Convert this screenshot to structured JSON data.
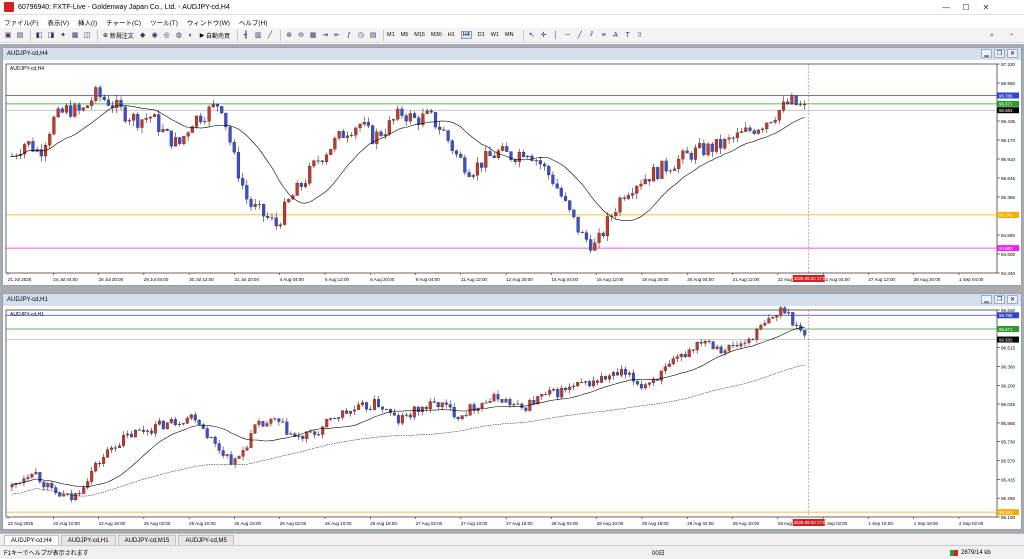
{
  "window": {
    "title": "60796940: FXTF-Live - Goldenway Japan Co., Ltd. - AUDJPY-cd,H4",
    "min": "—",
    "max": "☐",
    "close": "✕"
  },
  "menu": [
    "ファイル(F)",
    "表示(V)",
    "挿入(I)",
    "チャート(C)",
    "ツール(T)",
    "ウィンドウ(W)",
    "ヘルプ(H)"
  ],
  "toolbar": {
    "new_order": "新規注文",
    "auto_trade": "自動売買",
    "timeframes": [
      "M1",
      "M5",
      "M15",
      "M30",
      "H1",
      "H4",
      "D1",
      "W1",
      "MN"
    ],
    "active_timeframe": "H4"
  },
  "chart_top": {
    "window_title": "AUDJPY-cd,H4",
    "label": "AUDJPY-cd,H4",
    "price_ticks": [
      "97.220",
      "96.960",
      "96.695",
      "96.435",
      "96.170",
      "95.910",
      "95.645",
      "95.385",
      "95.125",
      "94.860",
      "94.600",
      "94.340"
    ],
    "price_labels": {
      "blue": "96.786",
      "green": "96.671",
      "current": "96.583",
      "orange": "95.141",
      "magenta": "94.683"
    },
    "time_ticks": [
      "21 Jul 2025",
      "24 Jul 04:00",
      "25 Jul 20:00",
      "29 Jul 04:00",
      "30 Jul 12:00",
      "31 Jul 20:00",
      "4 Aug 04:00",
      "5 Aug 12:00",
      "6 Aug 20:00",
      "8 Aug 04:00",
      "11 Aug 12:00",
      "12 Aug 20:00",
      "14 Aug 04:00",
      "15 Aug 12:00",
      "18 Aug 20:00",
      "20 Aug 04:00",
      "21 Aug 12:00",
      "22 Aug 20:00",
      "26 Aug 04:00",
      "27 Aug 12:00",
      "28 Aug 20:00",
      "1 Sep 04:00"
    ],
    "cursor_time": "2025.09.02 17:00"
  },
  "chart_bottom": {
    "window_title": "AUDJPY-cd,H1",
    "label": "AUDJPY-cd,H1",
    "price_ticks": [
      "96.830",
      "96.675",
      "96.515",
      "96.360",
      "96.200",
      "96.045",
      "95.885",
      "95.730",
      "95.570",
      "95.415",
      "95.260",
      "95.100"
    ],
    "price_labels": {
      "blue": "96.786",
      "green": "96.671",
      "current": "96.583",
      "orange": "95.141"
    },
    "time_ticks": [
      "22 Aug 2025",
      "22 Aug 10:00",
      "22 Aug 18:00",
      "25 Aug 02:00",
      "25 Aug 10:00",
      "25 Aug 18:00",
      "26 Aug 02:00",
      "26 Aug 10:00",
      "26 Aug 18:00",
      "27 Aug 02:00",
      "27 Aug 10:00",
      "27 Aug 18:00",
      "28 Aug 02:00",
      "28 Aug 10:00",
      "28 Aug 18:00",
      "29 Aug 02:00",
      "29 Aug 10:00",
      "29 Aug 18:00",
      "1 Sep 02:00",
      "1 Sep 10:00",
      "1 Sep 18:00",
      "2 Sep 02:00"
    ],
    "cursor_time": "2025.09.02 17:00"
  },
  "tabs": [
    "AUDJPY-cd,H4",
    "AUDJPY-cd,H1",
    "AUDJPY-cd,M15",
    "AUDJPY-cd,M5"
  ],
  "active_tab": 0,
  "status": {
    "help": "F1キーでヘルプが表示されます",
    "profile": "00日",
    "traffic": "2879/14 kb"
  },
  "colors": {
    "bull": "#c0392b",
    "bear": "#3a4fc9",
    "blue_line": "#3344cc",
    "green_line": "#2e9b2e",
    "orange_line": "#f0b000",
    "magenta_line": "#ee22ee",
    "cursor": "#e06060"
  },
  "chart_data": [
    {
      "type": "candlestick",
      "title": "AUDJPY-cd,H4",
      "ylim": [
        94.34,
        97.22
      ],
      "levels": [
        96.786,
        96.671,
        96.583,
        95.141,
        94.683
      ],
      "close_path": [
        95.95,
        96.15,
        96.0,
        96.45,
        96.6,
        96.55,
        96.8,
        96.7,
        96.55,
        96.45,
        96.5,
        96.25,
        96.1,
        96.45,
        96.55,
        96.7,
        95.9,
        95.3,
        95.15,
        95.0,
        95.35,
        95.6,
        95.9,
        96.1,
        96.3,
        96.4,
        96.2,
        96.35,
        96.55,
        96.45,
        96.5,
        96.3,
        95.95,
        95.75,
        95.9,
        96.0,
        95.95,
        96.05,
        95.85,
        95.6,
        95.2,
        94.85,
        94.7,
        95.1,
        95.45,
        95.6,
        95.7,
        95.8,
        95.9,
        96.0,
        96.05,
        96.1,
        96.2,
        96.3,
        96.4,
        96.55,
        96.7,
        96.6
      ]
    },
    {
      "type": "candlestick",
      "title": "AUDJPY-cd,H1",
      "ylim": [
        95.1,
        96.83
      ],
      "levels": [
        96.786,
        96.671,
        96.583,
        95.141
      ],
      "close_path": [
        95.35,
        95.5,
        95.3,
        95.25,
        95.5,
        95.7,
        95.8,
        95.85,
        95.9,
        95.95,
        95.7,
        95.55,
        95.85,
        95.9,
        95.75,
        95.8,
        95.95,
        96.0,
        96.05,
        95.9,
        96.0,
        96.05,
        95.95,
        96.05,
        96.1,
        96.0,
        96.1,
        96.15,
        96.2,
        96.25,
        96.3,
        96.2,
        96.3,
        96.45,
        96.6,
        96.5,
        96.55,
        96.7,
        96.85,
        96.6
      ]
    }
  ]
}
